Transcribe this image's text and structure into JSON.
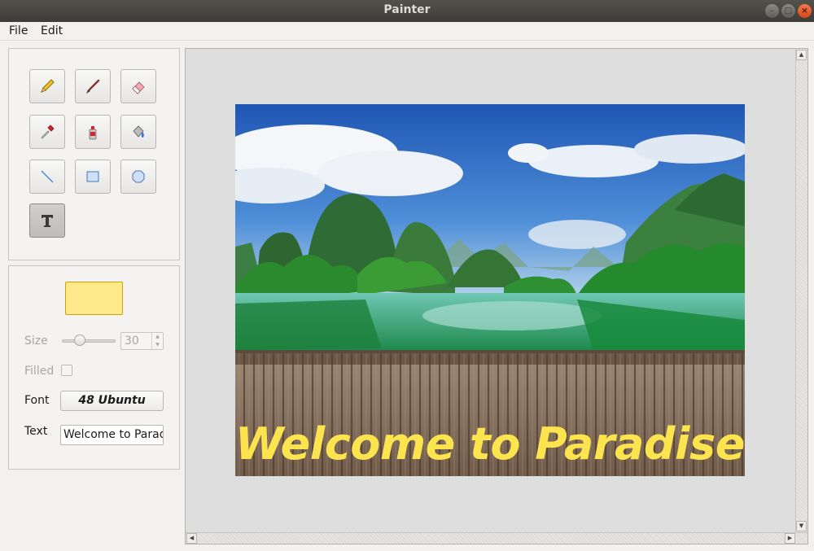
{
  "window": {
    "title": "Painter"
  },
  "menu": {
    "file": "File",
    "edit": "Edit"
  },
  "tools": [
    {
      "name": "pencil-icon",
      "id": "tool-pencil"
    },
    {
      "name": "brush-icon",
      "id": "tool-brush"
    },
    {
      "name": "eraser-icon",
      "id": "tool-eraser"
    },
    {
      "name": "color-picker-icon",
      "id": "tool-color-picker"
    },
    {
      "name": "spray-can-icon",
      "id": "tool-spray"
    },
    {
      "name": "paint-bucket-icon",
      "id": "tool-fill"
    },
    {
      "name": "line-icon",
      "id": "tool-line"
    },
    {
      "name": "rectangle-icon",
      "id": "tool-rectangle"
    },
    {
      "name": "ellipse-icon",
      "id": "tool-ellipse"
    },
    {
      "name": "text-tool-icon",
      "id": "tool-text"
    }
  ],
  "active_tool": "tool-text",
  "properties": {
    "color": "#fde88a",
    "size_label": "Size",
    "size_value": "30",
    "filled_label": "Filled",
    "filled_checked": false,
    "font_label": "Font",
    "font_value": "48 Ubuntu",
    "text_label": "Text",
    "text_value": "Welcome to Parad"
  },
  "canvas": {
    "overlay_text": "Welcome to Paradise!",
    "overlay_color": "#fbe44d"
  }
}
